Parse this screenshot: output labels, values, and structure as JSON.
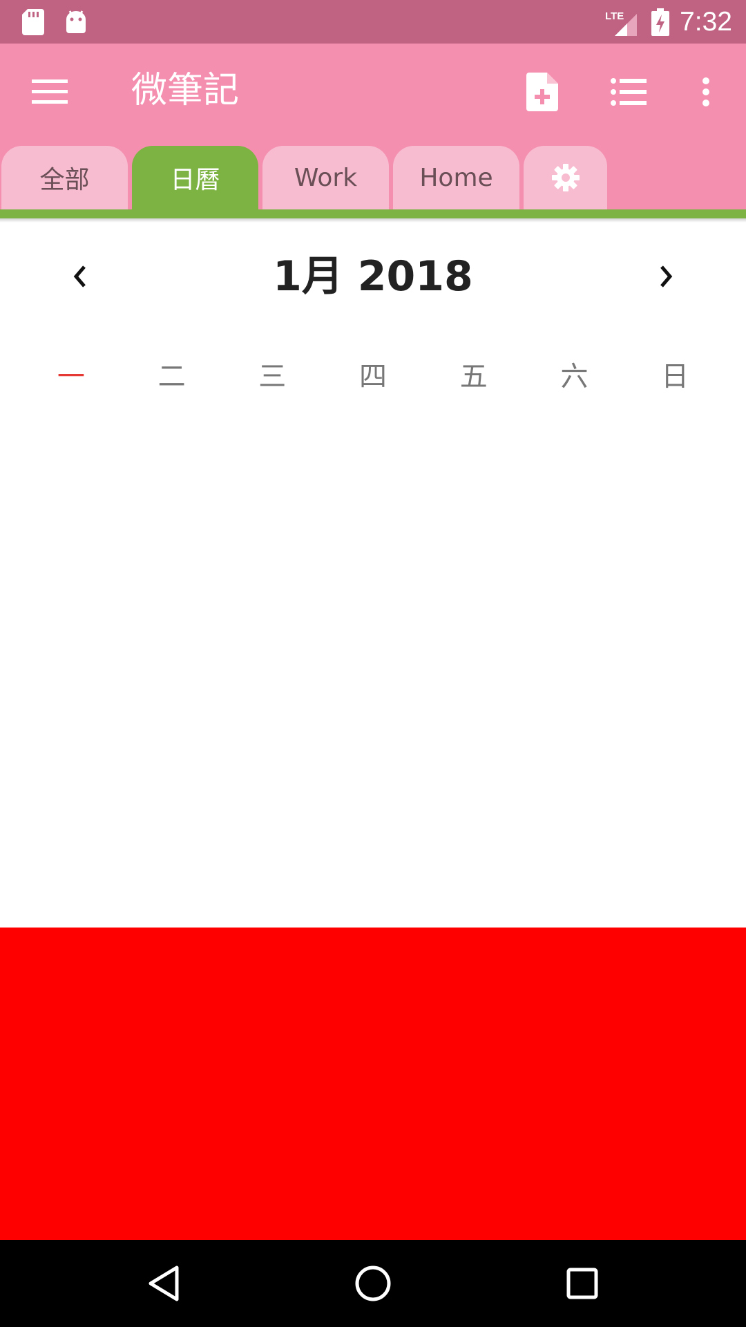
{
  "status_bar": {
    "time": "7:32",
    "network": "LTE",
    "icons": [
      "sd-card-icon",
      "android-icon",
      "signal-icon",
      "battery-charging-icon"
    ]
  },
  "app_bar": {
    "title": "微筆記",
    "actions": [
      "menu-icon",
      "new-note-icon",
      "list-view-icon",
      "more-vert-icon"
    ]
  },
  "tabs": [
    {
      "label": "全部",
      "active": false
    },
    {
      "label": "日曆",
      "active": true
    },
    {
      "label": "Work",
      "active": false
    },
    {
      "label": "Home",
      "active": false
    },
    {
      "label": "",
      "icon": "settings-icon",
      "active": false
    }
  ],
  "calendar": {
    "month_title": "1月 2018",
    "weekdays": [
      "一",
      "二",
      "三",
      "四",
      "五",
      "六",
      "日"
    ]
  },
  "colors": {
    "status_bar": "#c06383",
    "app_bar": "#f48fb0",
    "tab_inactive": "#f8bcd0",
    "tab_active": "#7cb342",
    "weekday_highlight": "#e53935",
    "ad_block": "#ff0000"
  }
}
